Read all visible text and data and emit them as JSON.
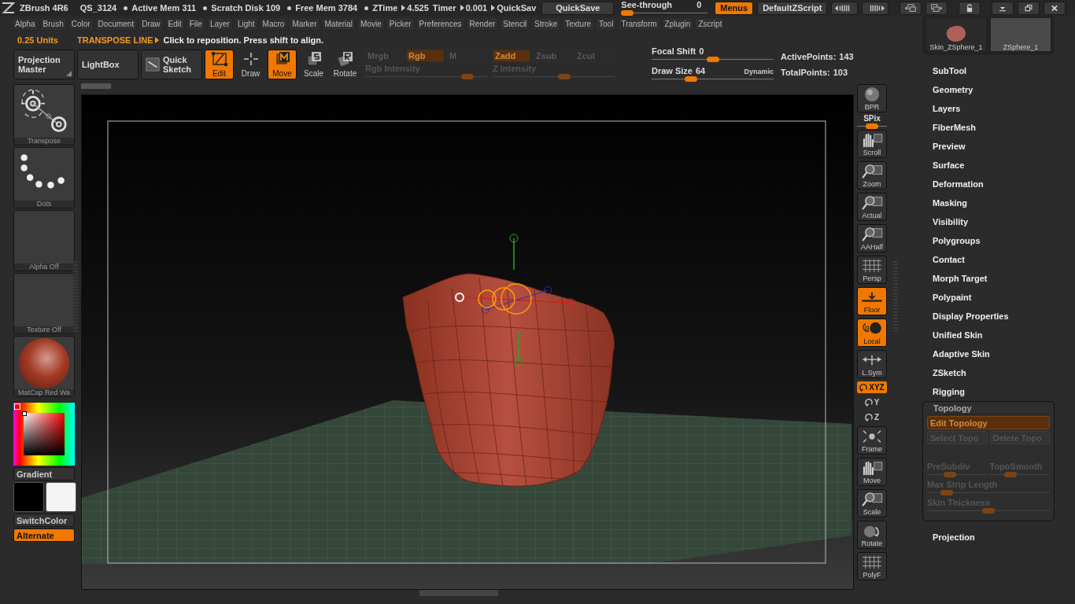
{
  "title_bar": {
    "app": "ZBrush 4R6",
    "file": "QS_3124",
    "stats": [
      {
        "label": "Active Mem",
        "value": "311"
      },
      {
        "label": "Scratch Disk",
        "value": "109"
      },
      {
        "label": "Free Mem",
        "value": "3784"
      }
    ],
    "timers": [
      {
        "label": "ZTime",
        "value": "4.525"
      },
      {
        "label": "Timer",
        "value": "0.001"
      }
    ],
    "quicksave_cut": "QuickSav",
    "quicksave": "QuickSave",
    "see_through": {
      "label": "See-through",
      "value": "0",
      "level": 0
    },
    "menus_button": {
      "label": "Menus",
      "selected": true
    },
    "script_button": "DefaultZScript"
  },
  "menus": [
    "Alpha",
    "Brush",
    "Color",
    "Document",
    "Draw",
    "Edit",
    "File",
    "Layer",
    "Light",
    "Macro",
    "Marker",
    "Material",
    "Movie",
    "Picker",
    "Preferences",
    "Render",
    "Stencil",
    "Stroke",
    "Texture",
    "Tool",
    "Transform",
    "Zplugin",
    "Zscript"
  ],
  "status": {
    "units": "0.25 Units",
    "mode": "TRANSPOSE LINE",
    "hint": "Click to reposition. Press shift to align."
  },
  "toolbar": {
    "buttons": [
      {
        "label": "Projection Master"
      },
      {
        "label": "LightBox"
      },
      {
        "label": "Quick Sketch"
      }
    ],
    "modes": [
      {
        "label": "Edit",
        "on": true
      },
      {
        "label": "Draw",
        "on": false
      },
      {
        "label": "Move",
        "on": true
      },
      {
        "label": "Scale",
        "on": false
      },
      {
        "label": "Rotate",
        "on": false
      }
    ],
    "channel_groups": [
      {
        "buttons": [
          {
            "label": "Mrgb",
            "on": false
          },
          {
            "label": "Rgb",
            "on": true
          },
          {
            "label": "M",
            "on": false
          }
        ],
        "slider": {
          "label": "Rgb Intensity",
          "level": 0.88
        }
      },
      {
        "buttons": [
          {
            "label": "Zadd",
            "on": true
          },
          {
            "label": "Zsub",
            "on": false
          },
          {
            "label": "Zcut",
            "on": false
          }
        ],
        "slider": {
          "label": "Z Intensity",
          "level": 0.6
        }
      }
    ],
    "sliders": [
      {
        "label": "Focal Shift",
        "value": "0",
        "level": 0.5
      },
      {
        "label": "Draw Size",
        "value": "64",
        "level": 0.3,
        "note": "Dynamic"
      }
    ],
    "points": [
      {
        "label": "ActivePoints:",
        "value": "143"
      },
      {
        "label": "TotalPoints:",
        "value": "103"
      }
    ]
  },
  "left_tiles": [
    {
      "label": "Transpose"
    },
    {
      "label": "Dots"
    },
    {
      "label": "Alpha Off"
    },
    {
      "label": "Texture Off"
    },
    {
      "label": "MatCap Red Wa"
    }
  ],
  "color": {
    "gradient": "Gradient",
    "switch": "SwitchColor",
    "alternate": {
      "label": "Alternate",
      "on": true
    }
  },
  "shelf": [
    {
      "kind": "button",
      "label": "BPR",
      "on": false
    },
    {
      "kind": "slider",
      "label": "SPix",
      "level": 0.5
    },
    {
      "kind": "button",
      "label": "Scroll",
      "on": false
    },
    {
      "kind": "button",
      "label": "Zoom",
      "on": false
    },
    {
      "kind": "button",
      "label": "Actual",
      "on": false
    },
    {
      "kind": "button",
      "label": "AAHalf",
      "on": false
    },
    {
      "kind": "button",
      "label": "Persp",
      "on": false
    },
    {
      "kind": "button",
      "label": "Floor",
      "on": true
    },
    {
      "kind": "button",
      "label": "Local",
      "on": true
    },
    {
      "kind": "button",
      "label": "L.Sym",
      "on": false
    },
    {
      "kind": "axis",
      "label": "XYZ",
      "on": true
    },
    {
      "kind": "axis",
      "label": "Y",
      "on": false
    },
    {
      "kind": "axis",
      "label": "Z",
      "on": false
    },
    {
      "kind": "button",
      "label": "Frame",
      "on": false
    },
    {
      "kind": "button",
      "label": "Move",
      "on": false
    },
    {
      "kind": "button",
      "label": "Scale",
      "on": false
    },
    {
      "kind": "button",
      "label": "Rotate",
      "on": false
    },
    {
      "kind": "button",
      "label": "PolyF",
      "on": false
    }
  ],
  "subtools": [
    {
      "name": "Skin_ZSphere_1",
      "selected": false
    },
    {
      "name": "ZSphere_1",
      "selected": true
    }
  ],
  "palette": [
    {
      "label": "SubTool",
      "expanded": false
    },
    {
      "label": "Geometry",
      "expanded": false
    },
    {
      "label": "Layers",
      "expanded": false
    },
    {
      "label": "FiberMesh",
      "expanded": false
    },
    {
      "label": "Preview",
      "expanded": false
    },
    {
      "label": "Surface",
      "expanded": false
    },
    {
      "label": "Deformation",
      "expanded": false
    },
    {
      "label": "Masking",
      "expanded": false
    },
    {
      "label": "Visibility",
      "expanded": false
    },
    {
      "label": "Polygroups",
      "expanded": false
    },
    {
      "label": "Contact",
      "expanded": false
    },
    {
      "label": "Morph Target",
      "expanded": false
    },
    {
      "label": "Polypaint",
      "expanded": false
    },
    {
      "label": "Display Properties",
      "expanded": false
    },
    {
      "label": "Unified Skin",
      "expanded": false
    },
    {
      "label": "Adaptive Skin",
      "expanded": false
    },
    {
      "label": "ZSketch",
      "expanded": false
    },
    {
      "label": "Rigging",
      "expanded": false
    },
    {
      "label": "Topology",
      "expanded": true,
      "button_rows": [
        {
          "buttons": [
            {
              "label": "Edit Topology",
              "on": true
            }
          ]
        },
        {
          "buttons": [
            {
              "label": "Select Topo",
              "on": false
            },
            {
              "label": "Delete Topo",
              "on": false
            }
          ]
        }
      ],
      "slider_rows": [
        {
          "sliders": [
            {
              "label": "PreSubdiv",
              "level": 0.35
            },
            {
              "label": "TopoSmooth",
              "level": 0.3
            }
          ]
        },
        {
          "sliders": [
            {
              "label": "Max Strip Length",
              "level": 0.12
            }
          ]
        },
        {
          "sliders": [
            {
              "label": "Skin Thickness",
              "level": 0.5
            }
          ]
        }
      ]
    },
    {
      "label": "Projection",
      "expanded": false
    }
  ]
}
